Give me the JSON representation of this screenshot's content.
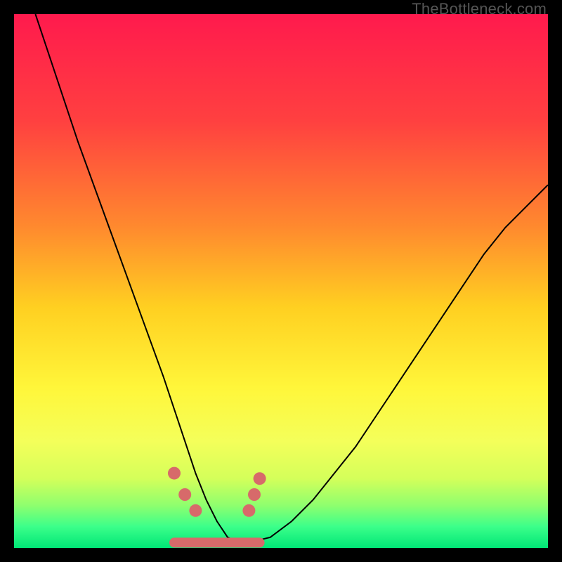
{
  "watermark": "TheBottleneck.com",
  "chart_data": {
    "type": "line",
    "title": "",
    "xlabel": "",
    "ylabel": "",
    "xlim": [
      0,
      100
    ],
    "ylim": [
      0,
      100
    ],
    "grid": false,
    "legend": false,
    "series": [
      {
        "name": "bottleneck-curve",
        "x": [
          4,
          8,
          12,
          16,
          20,
          24,
          28,
          30,
          32,
          34,
          36,
          38,
          40,
          42,
          44,
          48,
          52,
          56,
          60,
          64,
          68,
          72,
          76,
          80,
          84,
          88,
          92,
          96,
          100
        ],
        "values": [
          100,
          88,
          76,
          65,
          54,
          43,
          32,
          26,
          20,
          14,
          9,
          5,
          2,
          1,
          1,
          2,
          5,
          9,
          14,
          19,
          25,
          31,
          37,
          43,
          49,
          55,
          60,
          64,
          68
        ]
      }
    ],
    "markers": {
      "name": "trough-markers",
      "color": "#d76a6a",
      "points": [
        {
          "x": 30,
          "y": 14
        },
        {
          "x": 32,
          "y": 10
        },
        {
          "x": 34,
          "y": 7
        },
        {
          "x": 44,
          "y": 7
        },
        {
          "x": 45,
          "y": 10
        },
        {
          "x": 46,
          "y": 13
        }
      ]
    },
    "background_gradient": {
      "stops": [
        {
          "offset": 0.0,
          "color": "#ff1a4d"
        },
        {
          "offset": 0.2,
          "color": "#ff4040"
        },
        {
          "offset": 0.4,
          "color": "#ff8a2e"
        },
        {
          "offset": 0.55,
          "color": "#ffd021"
        },
        {
          "offset": 0.7,
          "color": "#fff63a"
        },
        {
          "offset": 0.8,
          "color": "#f4ff5a"
        },
        {
          "offset": 0.87,
          "color": "#d4ff5a"
        },
        {
          "offset": 0.92,
          "color": "#8fff6e"
        },
        {
          "offset": 0.96,
          "color": "#3cff8a"
        },
        {
          "offset": 1.0,
          "color": "#00e676"
        }
      ]
    }
  }
}
